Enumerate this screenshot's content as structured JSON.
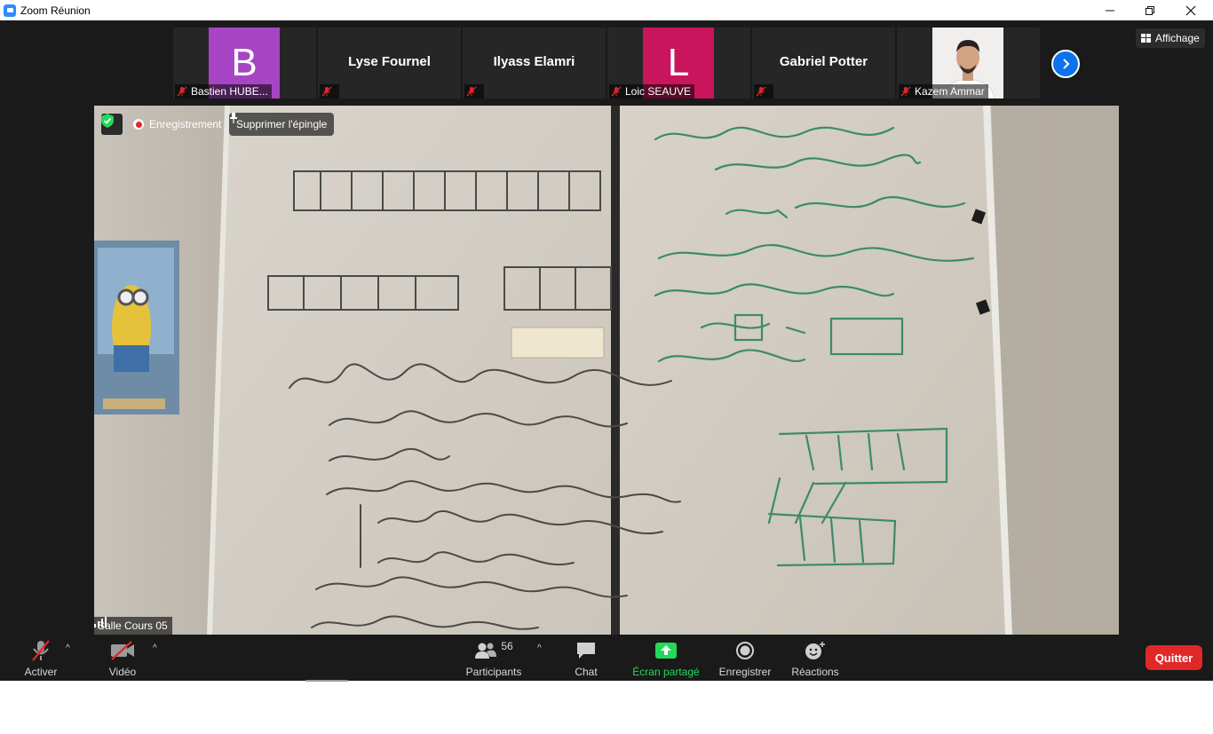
{
  "window": {
    "title": "Zoom Réunion",
    "minimize_icon": "minimize-icon",
    "restore_icon": "restore-icon",
    "close_icon": "close-icon"
  },
  "gallery": {
    "participants": [
      {
        "name": "Bastien HUBE...",
        "type": "letter",
        "letter": "B",
        "color": "#a845c4",
        "muted": true
      },
      {
        "name": "Lyse Fournel",
        "type": "name-only",
        "muted": true
      },
      {
        "name": "Ilyass Elamri",
        "type": "name-only",
        "muted": true
      },
      {
        "name": "Loic SEAUVE",
        "type": "letter",
        "letter": "L",
        "color": "#c8155c",
        "muted": true
      },
      {
        "name": "Gabriel Potter",
        "type": "name-only",
        "muted": true
      },
      {
        "name": "Kazem Ammar",
        "type": "photo",
        "muted": true
      }
    ],
    "next_page_icon": "chevron-right-icon"
  },
  "view_button": {
    "label": "Affichage",
    "icon": "grid-icon"
  },
  "main_video": {
    "security_icon": "shield-check-icon",
    "recording_label": "Enregistrement",
    "unpin_label": "Supprimer l'épingle",
    "speaker_label": "Salle Cours 05",
    "signal_icon": "signal-bars-icon"
  },
  "toolbar": {
    "audio_label": "Activer",
    "video_label": "Vidéo",
    "participants_label": "Participants",
    "participants_count": "56",
    "chat_label": "Chat",
    "share_label": "Écran partagé",
    "record_label": "Enregistrer",
    "reactions_label": "Réactions",
    "quit_label": "Quitter"
  },
  "colors": {
    "accent": "#0e72ed",
    "share_green": "#23d959",
    "quit_red": "#e02828",
    "background": "#1a1a1a"
  }
}
